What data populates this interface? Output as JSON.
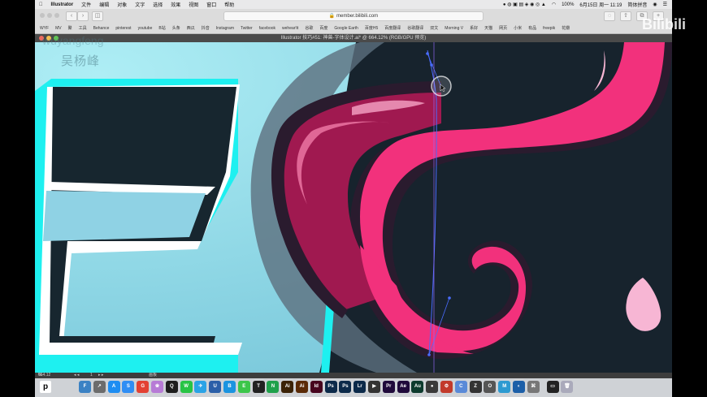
{
  "menubar": {
    "app": "Illustrator",
    "items": [
      "文件",
      "编辑",
      "对象",
      "文字",
      "选择",
      "效果",
      "视图",
      "窗口",
      "帮助"
    ],
    "battery": "100%",
    "datetime": "6月15日 周一 11:19",
    "input_method": "简体拼音"
  },
  "safari": {
    "url": "member.bilibili.com",
    "bookmarks": [
      "WYF",
      "MV",
      "聚",
      "工具",
      "Behance",
      "pinterest",
      "youtube",
      "B站",
      "头条",
      "西瓜",
      "抖音",
      "Instagram",
      "Twitter",
      "facebook",
      "wehear!it",
      "谷歌",
      "百度",
      "Google Earth",
      "百度H5",
      "百度翻译",
      "谷歌翻译",
      "双文",
      "Morning V",
      "系好",
      "天猫",
      "网页",
      "小米",
      "有品",
      "freepik",
      "花瓣"
    ]
  },
  "illustrator": {
    "doc_title": "Illustrator 技巧#51: 神兽-字体设计.ai* @ 664.12% (RGB/GPU 预览)",
    "zoom": "664.12",
    "page": "1",
    "status_tool": "画板"
  },
  "watermark": {
    "name_cn": "吴杨峰",
    "name_en": "wuyangfeng"
  },
  "bilibili": {
    "logo": "Bilibili"
  },
  "colors": {
    "sky": "#8fdde9",
    "cyan_accent": "#1ef0f0",
    "navy": "#17262f",
    "pink": "#f2317c",
    "dark_pink": "#a01950",
    "light_pink": "#f7b6d4",
    "outline": "#2a1b2e"
  },
  "dock": {
    "apps": [
      {
        "label": "F",
        "color": "#3b82c4",
        "icon": "finder-icon"
      },
      {
        "label": "↗",
        "color": "#6c6c6c",
        "icon": "launchpad-icon"
      },
      {
        "label": "A",
        "color": "#1d8df2",
        "icon": "appstore-icon"
      },
      {
        "label": "S",
        "color": "#2f8ef4",
        "icon": "safari-icon"
      },
      {
        "label": "G",
        "color": "#e34133",
        "icon": "chrome-icon"
      },
      {
        "label": "❀",
        "color": "#b77bd6",
        "icon": "photos-icon"
      },
      {
        "label": "Q",
        "color": "#1d1d1d",
        "icon": "qq-icon"
      },
      {
        "label": "W",
        "color": "#28c445",
        "icon": "wechat-icon"
      },
      {
        "label": "✈",
        "color": "#2aa3e6",
        "icon": "send-icon"
      },
      {
        "label": "U",
        "color": "#2b5fa8",
        "icon": "u-icon"
      },
      {
        "label": "B",
        "color": "#1b94e0",
        "icon": "baidu-netdisk-icon"
      },
      {
        "label": "E",
        "color": "#3cc64a",
        "icon": "evernote-icon"
      },
      {
        "label": "T",
        "color": "#222",
        "icon": "typora-icon"
      },
      {
        "label": "N",
        "color": "#1fa14b",
        "icon": "notes-icon"
      },
      {
        "label": "Ai",
        "color": "#3b2206",
        "icon": "illustrator-icon"
      },
      {
        "label": "Ai",
        "color": "#5a2a07",
        "icon": "illustrator-2-icon"
      },
      {
        "label": "Id",
        "color": "#47041e",
        "icon": "indesign-icon"
      },
      {
        "label": "Ps",
        "color": "#0c2a4a",
        "icon": "photoshop-icon"
      },
      {
        "label": "Ps",
        "color": "#0c2a4a",
        "icon": "photoshop-2-icon"
      },
      {
        "label": "Lr",
        "color": "#0c2a4a",
        "icon": "lightroom-icon"
      },
      {
        "label": "▶",
        "color": "#333",
        "icon": "video-icon"
      },
      {
        "label": "Pr",
        "color": "#1f0a3b",
        "icon": "premiere-icon"
      },
      {
        "label": "Ae",
        "color": "#1f0a3b",
        "icon": "aftereffects-icon"
      },
      {
        "label": "Au",
        "color": "#0d3b2e",
        "icon": "audition-icon"
      },
      {
        "label": "●",
        "color": "#3a3a3a",
        "icon": "record-icon"
      },
      {
        "label": "⚙",
        "color": "#c23a2b",
        "icon": "tool-icon"
      },
      {
        "label": "C",
        "color": "#5a8ad8",
        "icon": "cinema-icon"
      },
      {
        "label": "Z",
        "color": "#333",
        "icon": "zbrush-icon"
      },
      {
        "label": "O",
        "color": "#555",
        "icon": "obs-icon"
      },
      {
        "label": "M",
        "color": "#2c9ad1",
        "icon": "m-icon"
      },
      {
        "label": "◐",
        "color": "#1c5fa8",
        "icon": "c4d-icon"
      },
      {
        "label": "⌘",
        "color": "#777",
        "icon": "sysprefs-icon"
      },
      {
        "label": "▭",
        "color": "#222",
        "icon": "screen-icon"
      },
      {
        "label": "🗑",
        "color": "#aab",
        "icon": "trash-icon"
      }
    ]
  }
}
